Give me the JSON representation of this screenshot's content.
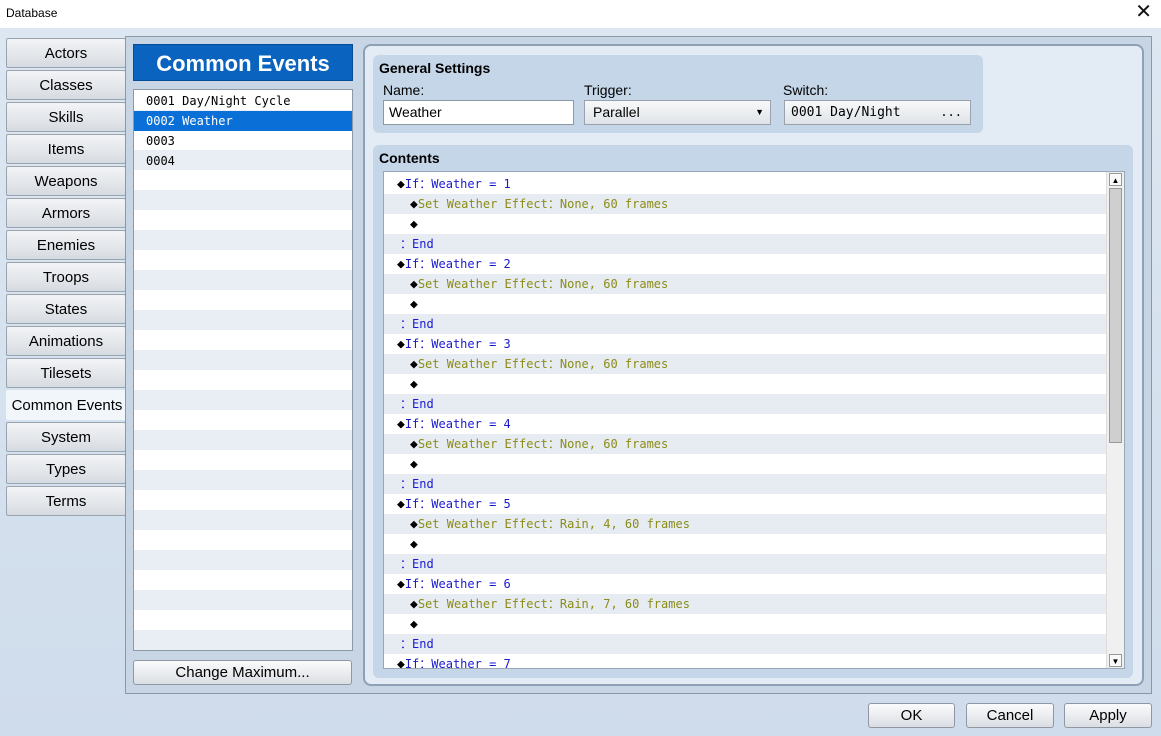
{
  "window": {
    "title": "Database",
    "close_glyph": "✕"
  },
  "tabs": [
    {
      "label": "Actors"
    },
    {
      "label": "Classes"
    },
    {
      "label": "Skills"
    },
    {
      "label": "Items"
    },
    {
      "label": "Weapons"
    },
    {
      "label": "Armors"
    },
    {
      "label": "Enemies"
    },
    {
      "label": "Troops"
    },
    {
      "label": "States"
    },
    {
      "label": "Animations"
    },
    {
      "label": "Tilesets"
    },
    {
      "label": "Common Events"
    },
    {
      "label": "System"
    },
    {
      "label": "Types"
    },
    {
      "label": "Terms"
    }
  ],
  "active_tab": "Common Events",
  "list": {
    "title": "Common Events",
    "items": [
      "0001 Day/Night Cycle",
      "0002 Weather",
      "0003",
      "0004"
    ],
    "selected_index": 1,
    "change_max_label": "Change Maximum..."
  },
  "general": {
    "title": "General Settings",
    "name_label": "Name:",
    "name_value": "Weather",
    "trigger_label": "Trigger:",
    "trigger_value": "Parallel",
    "switch_label": "Switch:",
    "switch_value": "0001 Day/Night",
    "switch_button": "..."
  },
  "contents": {
    "title": "Contents",
    "lines": [
      {
        "indent": 1,
        "marker": "◆",
        "text": "If：Weather = 1",
        "color": "blue"
      },
      {
        "indent": 2,
        "marker": "◆",
        "text": "Set Weather Effect：None, 60 frames",
        "color": "olive"
      },
      {
        "indent": 2,
        "marker": "◆",
        "text": "",
        "color": "blue"
      },
      {
        "indent": 1,
        "marker": "",
        "text": "：End",
        "color": "blue"
      },
      {
        "indent": 1,
        "marker": "◆",
        "text": "If：Weather = 2",
        "color": "blue"
      },
      {
        "indent": 2,
        "marker": "◆",
        "text": "Set Weather Effect：None, 60 frames",
        "color": "olive"
      },
      {
        "indent": 2,
        "marker": "◆",
        "text": "",
        "color": "blue"
      },
      {
        "indent": 1,
        "marker": "",
        "text": "：End",
        "color": "blue"
      },
      {
        "indent": 1,
        "marker": "◆",
        "text": "If：Weather = 3",
        "color": "blue"
      },
      {
        "indent": 2,
        "marker": "◆",
        "text": "Set Weather Effect：None, 60 frames",
        "color": "olive"
      },
      {
        "indent": 2,
        "marker": "◆",
        "text": "",
        "color": "blue"
      },
      {
        "indent": 1,
        "marker": "",
        "text": "：End",
        "color": "blue"
      },
      {
        "indent": 1,
        "marker": "◆",
        "text": "If：Weather = 4",
        "color": "blue"
      },
      {
        "indent": 2,
        "marker": "◆",
        "text": "Set Weather Effect：None, 60 frames",
        "color": "olive"
      },
      {
        "indent": 2,
        "marker": "◆",
        "text": "",
        "color": "blue"
      },
      {
        "indent": 1,
        "marker": "",
        "text": "：End",
        "color": "blue"
      },
      {
        "indent": 1,
        "marker": "◆",
        "text": "If：Weather = 5",
        "color": "blue"
      },
      {
        "indent": 2,
        "marker": "◆",
        "text": "Set Weather Effect：Rain, 4, 60 frames",
        "color": "olive"
      },
      {
        "indent": 2,
        "marker": "◆",
        "text": "",
        "color": "blue"
      },
      {
        "indent": 1,
        "marker": "",
        "text": "：End",
        "color": "blue"
      },
      {
        "indent": 1,
        "marker": "◆",
        "text": "If：Weather = 6",
        "color": "blue"
      },
      {
        "indent": 2,
        "marker": "◆",
        "text": "Set Weather Effect：Rain, 7, 60 frames",
        "color": "olive"
      },
      {
        "indent": 2,
        "marker": "◆",
        "text": "",
        "color": "blue"
      },
      {
        "indent": 1,
        "marker": "",
        "text": "：End",
        "color": "blue"
      },
      {
        "indent": 1,
        "marker": "◆",
        "text": "If：Weather = 7",
        "color": "blue"
      }
    ]
  },
  "scrollbar": {
    "position_fraction": 0.0,
    "visible_fraction": 0.55
  },
  "footer": {
    "ok_label": "OK",
    "cancel_label": "Cancel",
    "apply_label": "Apply"
  },
  "colors": {
    "accent": "#0a64bf",
    "selection": "#0a6fd6",
    "code_blue": "#1a1ad0",
    "code_olive": "#8c8c18"
  }
}
